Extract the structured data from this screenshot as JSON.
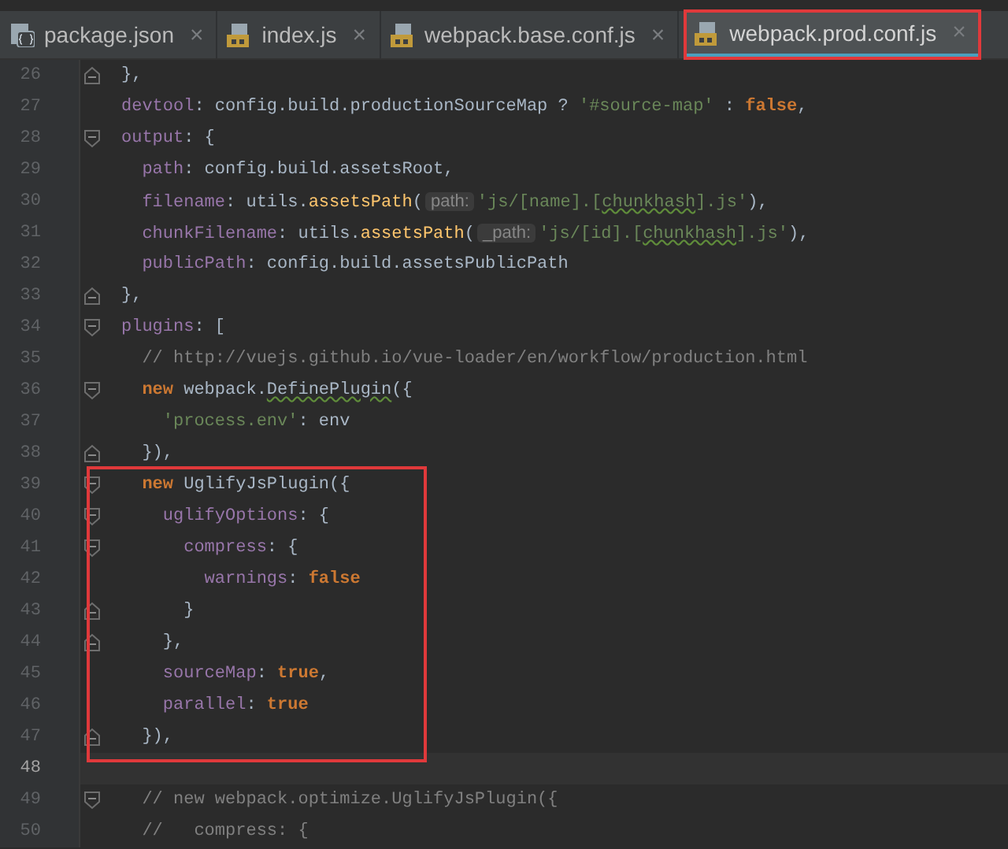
{
  "tabs": [
    {
      "label": "package.json",
      "kind": "json",
      "selected": false,
      "outlined": false,
      "close": "×"
    },
    {
      "label": "index.js",
      "kind": "js",
      "selected": false,
      "outlined": false,
      "close": "×"
    },
    {
      "label": "webpack.base.conf.js",
      "kind": "js",
      "selected": false,
      "outlined": false,
      "close": "×"
    },
    {
      "label": "webpack.prod.conf.js",
      "kind": "js",
      "selected": true,
      "outlined": true,
      "close": "×"
    }
  ],
  "code_lines": [
    {
      "number": "26",
      "kind": "closer",
      "boxed": false,
      "current": false,
      "tokens": [
        {
          "kind": "plain",
          "text": "},"
        }
      ]
    },
    {
      "number": "27",
      "kind": "plain",
      "boxed": false,
      "current": false,
      "tokens": [
        {
          "kind": "prop",
          "text": "devtool"
        },
        {
          "kind": "plain",
          "text": ": config.build.productionSourceMap ? "
        },
        {
          "kind": "string",
          "text": "'#source-map'"
        },
        {
          "kind": "plain",
          "text": " : "
        },
        {
          "kind": "keyword",
          "text": "false"
        },
        {
          "kind": "plain",
          "text": ","
        }
      ]
    },
    {
      "number": "28",
      "kind": "opener",
      "boxed": false,
      "current": false,
      "tokens": [
        {
          "kind": "prop",
          "text": "output"
        },
        {
          "kind": "plain",
          "text": ": {"
        }
      ]
    },
    {
      "number": "29",
      "kind": "plain",
      "boxed": false,
      "current": false,
      "tokens": [
        {
          "kind": "prop",
          "text": "  path"
        },
        {
          "kind": "plain",
          "text": ": config.build.assetsRoot,"
        }
      ]
    },
    {
      "number": "30",
      "kind": "plain",
      "boxed": false,
      "current": false,
      "tokens": [
        {
          "kind": "prop",
          "text": "  filename"
        },
        {
          "kind": "plain",
          "text": ": utils."
        },
        {
          "kind": "method",
          "text": "assetsPath"
        },
        {
          "kind": "plain",
          "text": "("
        },
        {
          "kind": "hint",
          "text": "path:"
        },
        {
          "kind": "string",
          "text": "'js/[name].["
        },
        {
          "kind": "string_underlined",
          "text": "chunkhash"
        },
        {
          "kind": "string",
          "text": "].js'"
        },
        {
          "kind": "plain",
          "text": "),"
        }
      ]
    },
    {
      "number": "31",
      "kind": "plain",
      "boxed": false,
      "current": false,
      "tokens": [
        {
          "kind": "prop",
          "text": "  chunkFilename"
        },
        {
          "kind": "plain",
          "text": ": utils."
        },
        {
          "kind": "method",
          "text": "assetsPath"
        },
        {
          "kind": "plain",
          "text": "("
        },
        {
          "kind": "hint",
          "text": "_path:"
        },
        {
          "kind": "string",
          "text": "'js/[id].["
        },
        {
          "kind": "string_underlined",
          "text": "chunkhash"
        },
        {
          "kind": "string",
          "text": "].js'"
        },
        {
          "kind": "plain",
          "text": "),"
        }
      ]
    },
    {
      "number": "32",
      "kind": "plain",
      "boxed": false,
      "current": false,
      "tokens": [
        {
          "kind": "prop",
          "text": "  publicPath"
        },
        {
          "kind": "plain",
          "text": ": config.build.assetsPublicPath"
        }
      ]
    },
    {
      "number": "33",
      "kind": "closer",
      "boxed": false,
      "current": false,
      "tokens": [
        {
          "kind": "plain",
          "text": "},"
        }
      ]
    },
    {
      "number": "34",
      "kind": "opener",
      "boxed": false,
      "current": false,
      "tokens": [
        {
          "kind": "prop",
          "text": "plugins"
        },
        {
          "kind": "plain",
          "text": ": ["
        }
      ]
    },
    {
      "number": "35",
      "kind": "plain",
      "boxed": false,
      "current": false,
      "tokens": [
        {
          "kind": "comment",
          "text": "  // http://vuejs.github.io/vue-loader/en/workflow/production.html"
        }
      ]
    },
    {
      "number": "36",
      "kind": "opener",
      "boxed": false,
      "current": false,
      "tokens": [
        {
          "kind": "keyword",
          "text": "  new "
        },
        {
          "kind": "plain",
          "text": "webpack."
        },
        {
          "kind": "plain_underlined",
          "text": "DefinePlugin"
        },
        {
          "kind": "plain",
          "text": "({"
        }
      ]
    },
    {
      "number": "37",
      "kind": "plain",
      "boxed": false,
      "current": false,
      "tokens": [
        {
          "kind": "string",
          "text": "    'process.env'"
        },
        {
          "kind": "plain",
          "text": ": env"
        }
      ]
    },
    {
      "number": "38",
      "kind": "closer",
      "boxed": false,
      "current": false,
      "tokens": [
        {
          "kind": "plain",
          "text": "  }),"
        }
      ]
    },
    {
      "number": "39",
      "kind": "opener",
      "boxed": true,
      "current": false,
      "tokens": [
        {
          "kind": "keyword",
          "text": "  new "
        },
        {
          "kind": "plain",
          "text": "UglifyJsPlugin({"
        }
      ]
    },
    {
      "number": "40",
      "kind": "opener",
      "boxed": true,
      "current": false,
      "tokens": [
        {
          "kind": "prop",
          "text": "    uglifyOptions"
        },
        {
          "kind": "plain",
          "text": ": {"
        }
      ]
    },
    {
      "number": "41",
      "kind": "opener",
      "boxed": true,
      "current": false,
      "tokens": [
        {
          "kind": "prop",
          "text": "      compress"
        },
        {
          "kind": "plain",
          "text": ": {"
        }
      ]
    },
    {
      "number": "42",
      "kind": "plain",
      "boxed": true,
      "current": false,
      "tokens": [
        {
          "kind": "prop",
          "text": "        warnings"
        },
        {
          "kind": "plain",
          "text": ": "
        },
        {
          "kind": "keyword",
          "text": "false"
        }
      ]
    },
    {
      "number": "43",
      "kind": "closer",
      "boxed": true,
      "current": false,
      "tokens": [
        {
          "kind": "plain",
          "text": "      }"
        }
      ]
    },
    {
      "number": "44",
      "kind": "closer",
      "boxed": true,
      "current": false,
      "tokens": [
        {
          "kind": "plain",
          "text": "    },"
        }
      ]
    },
    {
      "number": "45",
      "kind": "plain",
      "boxed": true,
      "current": false,
      "tokens": [
        {
          "kind": "prop",
          "text": "    sourceMap"
        },
        {
          "kind": "plain",
          "text": ": "
        },
        {
          "kind": "keyword",
          "text": "true"
        },
        {
          "kind": "plain",
          "text": ","
        }
      ]
    },
    {
      "number": "46",
      "kind": "plain",
      "boxed": true,
      "current": false,
      "tokens": [
        {
          "kind": "prop",
          "text": "    parallel"
        },
        {
          "kind": "plain",
          "text": ": "
        },
        {
          "kind": "keyword",
          "text": "true"
        }
      ]
    },
    {
      "number": "47",
      "kind": "closer",
      "boxed": true,
      "current": false,
      "tokens": [
        {
          "kind": "plain",
          "text": "  }),"
        }
      ]
    },
    {
      "number": "48",
      "kind": "plain",
      "boxed": false,
      "current": true
    },
    {
      "number": "49",
      "kind": "opener",
      "boxed": false,
      "current": false,
      "tokens": [
        {
          "kind": "comment",
          "text": "  // new webpack.optimize.UglifyJsPlugin({"
        }
      ]
    },
    {
      "number": "50",
      "kind": "plain",
      "boxed": false,
      "current": false,
      "tokens": [
        {
          "kind": "comment",
          "text": "  //   compress: {"
        }
      ]
    }
  ]
}
